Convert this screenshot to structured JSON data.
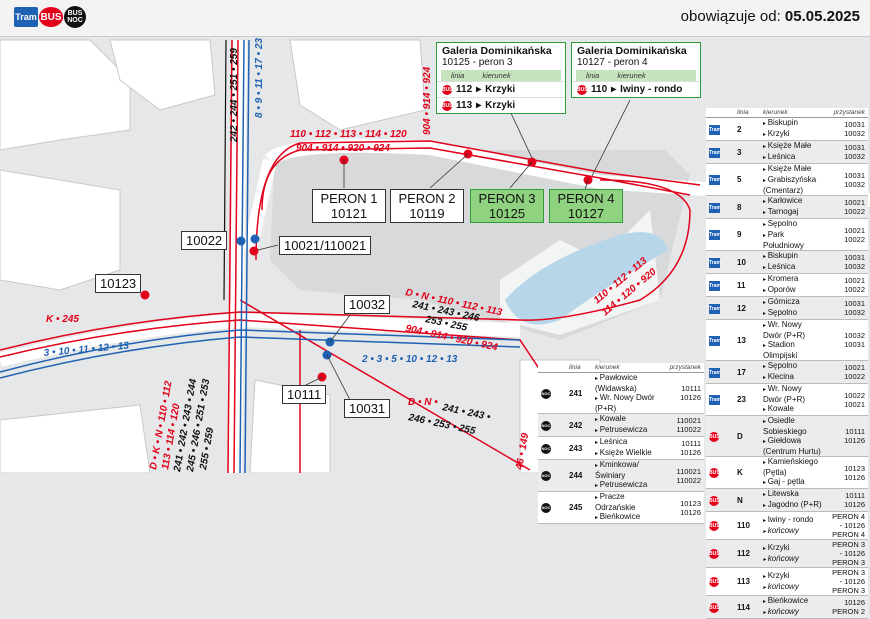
{
  "header": {
    "badges": {
      "tram": "Tram",
      "bus": "BUS",
      "bus_noc_top": "BUS",
      "bus_noc_bottom": "NOC"
    },
    "valid_prefix": "obowiązuje od:",
    "valid_date": "05.05.2025"
  },
  "colors": {
    "tram": "#1f62b3",
    "bus": "#e2001a",
    "night": "#111111",
    "highlight_green": "#8fd27f",
    "map_bg": "#e6e7e8"
  },
  "callouts": [
    {
      "title": "Galeria Dominikańska",
      "subtitle": "10125 - peron 3",
      "col_line": "linia",
      "col_dest": "kierunek",
      "rows": [
        {
          "line": "112",
          "dest": "Krzyki"
        },
        {
          "line": "113",
          "dest": "Krzyki"
        }
      ]
    },
    {
      "title": "Galeria Dominikańska",
      "subtitle": "10127 - peron 4",
      "col_line": "linia",
      "col_dest": "kierunek",
      "rows": [
        {
          "line": "110",
          "dest": "Iwiny - rondo"
        }
      ]
    }
  ],
  "platforms": [
    {
      "name": "PERON 1",
      "code": "10121"
    },
    {
      "name": "PERON 2",
      "code": "10119"
    },
    {
      "name": "PERON 3",
      "code": "10125"
    },
    {
      "name": "PERON 4",
      "code": "10127"
    }
  ],
  "stop_codes": {
    "s10022": "10022",
    "s10021": "10021/110021",
    "s10123": "10123",
    "s10032": "10032",
    "s10111": "10111",
    "s10031": "10031"
  },
  "route_labels": {
    "top_red_1": "110 • 112 • 113 • 114 • 120",
    "top_red_2": "904 • 914 • 920 • 924",
    "vert_red": "904 • 914 • 924",
    "vert_black": "242 • 244 • 251 • 259",
    "vert_blue": "8 • 9 • 11 • 17 • 23",
    "k245": "K • 245",
    "blue_left": "3 • 10 • 11 • 12 • 13",
    "blue_mid": "2 • 3 • 5 • 10 • 12 • 13",
    "mid_red_1": "D • N • 110 • 112 • 113",
    "mid_black_1": "241 • 243 • 246",
    "mid_black_2": "253 • 255",
    "mid_red_2": "904 • 914 • 920 • 924",
    "right_red": "110 • 112 • 113",
    "right_red_2": "114 • 120 • 920",
    "low_red": "D • N •",
    "low_black_1": "241 • 243 •",
    "low_black_2": "246 • 253 • 255",
    "bottom_left_red": "D • K • N • 110 • 112",
    "bottom_left_red_2": "113 • 114 • 120",
    "bottom_left_black": "241 • 242 • 243 • 244",
    "bottom_left_black_2": "245 • 246 • 251 • 253",
    "bottom_left_black_3": "255 • 259",
    "bottom_right": "46 • 149"
  },
  "right_table": {
    "col_line": "linia",
    "col_dest": "kierunek",
    "col_stop": "przystanek",
    "rows": [
      {
        "type": "tram",
        "line": "2",
        "dest": [
          "Biskupin",
          "Krzyki"
        ],
        "stop": [
          "10031",
          "10032"
        ]
      },
      {
        "type": "tram",
        "line": "3",
        "dest": [
          "Księże Małe",
          "Leśnica"
        ],
        "stop": [
          "10031",
          "10032"
        ]
      },
      {
        "type": "tram",
        "line": "5",
        "dest": [
          "Księże Małe",
          "Grabiszyńska (Cmentarz)"
        ],
        "stop": [
          "10031",
          "10032"
        ]
      },
      {
        "type": "tram",
        "line": "8",
        "dest": [
          "Karłowice",
          "Tarnogaj"
        ],
        "stop": [
          "10021",
          "10022"
        ]
      },
      {
        "type": "tram",
        "line": "9",
        "dest": [
          "Sępolno",
          "Park Południowy"
        ],
        "stop": [
          "10021",
          "10022"
        ]
      },
      {
        "type": "tram",
        "line": "10",
        "dest": [
          "Biskupin",
          "Leśnica"
        ],
        "stop": [
          "10031",
          "10032"
        ]
      },
      {
        "type": "tram",
        "line": "11",
        "dest": [
          "Kromera",
          "Oporów"
        ],
        "stop": [
          "10021",
          "10022"
        ]
      },
      {
        "type": "tram",
        "line": "12",
        "dest": [
          "Górnicza",
          "Sępolno"
        ],
        "stop": [
          "10031",
          "10032"
        ]
      },
      {
        "type": "tram",
        "line": "13",
        "dest": [
          "Wr. Nowy Dwór (P+R)",
          "Stadion Olimpijski"
        ],
        "stop": [
          "10032",
          "10031"
        ]
      },
      {
        "type": "tram",
        "line": "17",
        "dest": [
          "Sępolno",
          "Klecina"
        ],
        "stop": [
          "10021",
          "10022"
        ]
      },
      {
        "type": "tram",
        "line": "23",
        "dest": [
          "Wr. Nowy Dwór (P+R)",
          "Kowale"
        ],
        "stop": [
          "10022",
          "10021"
        ]
      },
      {
        "type": "bus",
        "line": "D",
        "dest": [
          "Osiedle Sobieskiego",
          "Giełdowa (Centrum Hurtu)"
        ],
        "stop": [
          "10111",
          "10126"
        ]
      },
      {
        "type": "bus",
        "line": "K",
        "dest": [
          "Kamieńskiego (Pętla)",
          "Gaj - pętla"
        ],
        "stop": [
          "10123",
          "10126"
        ]
      },
      {
        "type": "bus",
        "line": "N",
        "dest": [
          "Litewska",
          "Jagodno (P+R)"
        ],
        "stop": [
          "10111",
          "10126"
        ]
      },
      {
        "type": "bus",
        "line": "110",
        "dest": [
          "Iwiny - rondo",
          "końcowy"
        ],
        "stop": [
          "PERON 4 - 10126",
          "PERON 4"
        ]
      },
      {
        "type": "bus",
        "line": "112",
        "dest": [
          "Krzyki",
          "końcowy"
        ],
        "stop": [
          "PERON 3 - 10126",
          "PERON 3"
        ]
      },
      {
        "type": "bus",
        "line": "113",
        "dest": [
          "Krzyki",
          "końcowy"
        ],
        "stop": [
          "PERON 3 - 10126",
          "PERON 3"
        ]
      },
      {
        "type": "bus",
        "line": "114",
        "dest": [
          "Bieńkowice",
          "końcowy"
        ],
        "stop": [
          "10126",
          "PERON 2"
        ]
      }
    ]
  },
  "bottom_table": {
    "col_line": "linia",
    "col_dest": "kierunek",
    "col_stop": "przystanek",
    "rows": [
      {
        "line": "241",
        "dest": [
          "Pawłowice (Widawska)",
          "Wr. Nowy Dwór (P+R)"
        ],
        "stop": [
          "10111",
          "10126"
        ]
      },
      {
        "line": "242",
        "dest": [
          "Kowale",
          "Petrusewicza"
        ],
        "stop": [
          "110021",
          "110022"
        ]
      },
      {
        "line": "243",
        "dest": [
          "Leśnica",
          "Księże Wielkie"
        ],
        "stop": [
          "10111",
          "10126"
        ]
      },
      {
        "line": "244",
        "dest": [
          "Kminkowa/Świniary",
          "Petrusewicza"
        ],
        "stop": [
          "110021",
          "110022"
        ]
      },
      {
        "line": "245",
        "dest": [
          "Pracze Odrzańskie",
          "Bieńkowice"
        ],
        "stop": [
          "10123",
          "10126"
        ]
      }
    ]
  }
}
